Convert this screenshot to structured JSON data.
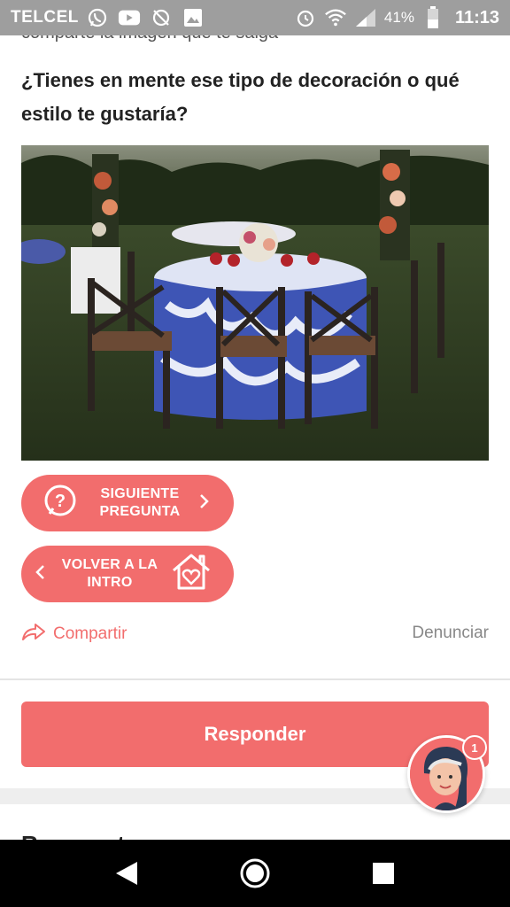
{
  "status_bar": {
    "carrier": "TELCEL",
    "battery": "41%",
    "time": "11:13",
    "icons": [
      "whatsapp-icon",
      "youtube-icon",
      "sync-off-icon",
      "image-icon",
      "alarm-icon",
      "wifi-icon",
      "signal-icon",
      "battery-icon"
    ]
  },
  "post": {
    "prev_line_cut": "comparte la imagen que te salga",
    "question": "¿Tienes en mente ese tipo de decoración o qué estilo te gustaría?"
  },
  "buttons": {
    "next_question": "SIGUIENTE PREGUNTA",
    "back_intro": "VOLVER A LA INTRO",
    "share": "Compartir",
    "report": "Denunciar",
    "respond": "Responder"
  },
  "next_section_cut": "Respuestas",
  "avatar": {
    "badge_count": "1"
  },
  "colors": {
    "accent": "#f26d6d",
    "statusbar": "#9e9e9e",
    "navbar": "#000000"
  }
}
